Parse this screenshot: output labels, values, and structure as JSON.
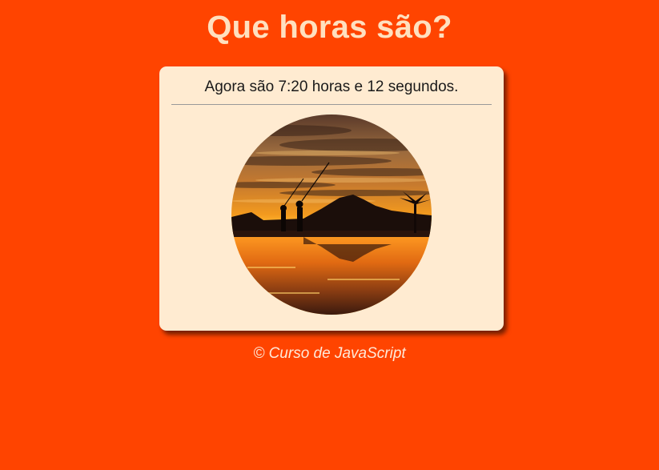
{
  "page": {
    "title": "Que horas são?",
    "background_color": "#ff4400",
    "title_color": "#ffe0bf"
  },
  "clock": {
    "message": "Agora são 7:20 horas e 12 segundos.",
    "card_color": "#ffebd1"
  },
  "image": {
    "icon": "sunset-photo",
    "scene": "sunset"
  },
  "footer": {
    "text": "© Curso de JavaScript"
  }
}
